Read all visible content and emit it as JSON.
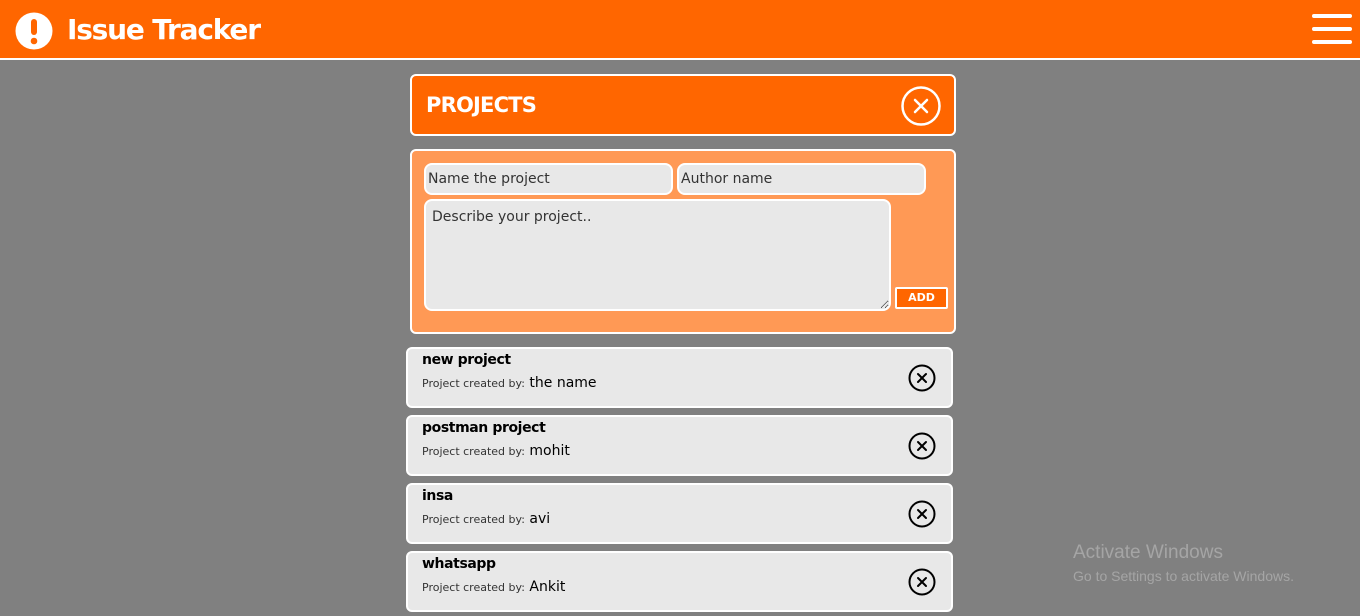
{
  "header": {
    "title": "Issue Tracker",
    "logo_icon": "exclamation-circle-icon",
    "menu_icon": "hamburger-menu-icon"
  },
  "panel": {
    "title": "PROJECTS",
    "close_icon": "close-circle-icon"
  },
  "form": {
    "name_placeholder": "Name the project",
    "name_value": "",
    "author_placeholder": "Author name",
    "author_value": "",
    "description_placeholder": "Describe your project..",
    "description_value": "",
    "add_label": "ADD"
  },
  "projects": [
    {
      "name": "new project",
      "created_by_label": "Project created by:",
      "author": "the name"
    },
    {
      "name": "postman project",
      "created_by_label": "Project created by:",
      "author": "mohit"
    },
    {
      "name": "insa",
      "created_by_label": "Project created by:",
      "author": "avi"
    },
    {
      "name": "whatsapp",
      "created_by_label": "Project created by:",
      "author": "Ankit"
    }
  ],
  "watermark": {
    "title": "Activate Windows",
    "subtitle": "Go to Settings to activate Windows."
  },
  "colors": {
    "accent": "#ff6600",
    "form_background": "#ff9955",
    "page_background": "#808080",
    "field_background": "#e8e8e8"
  }
}
